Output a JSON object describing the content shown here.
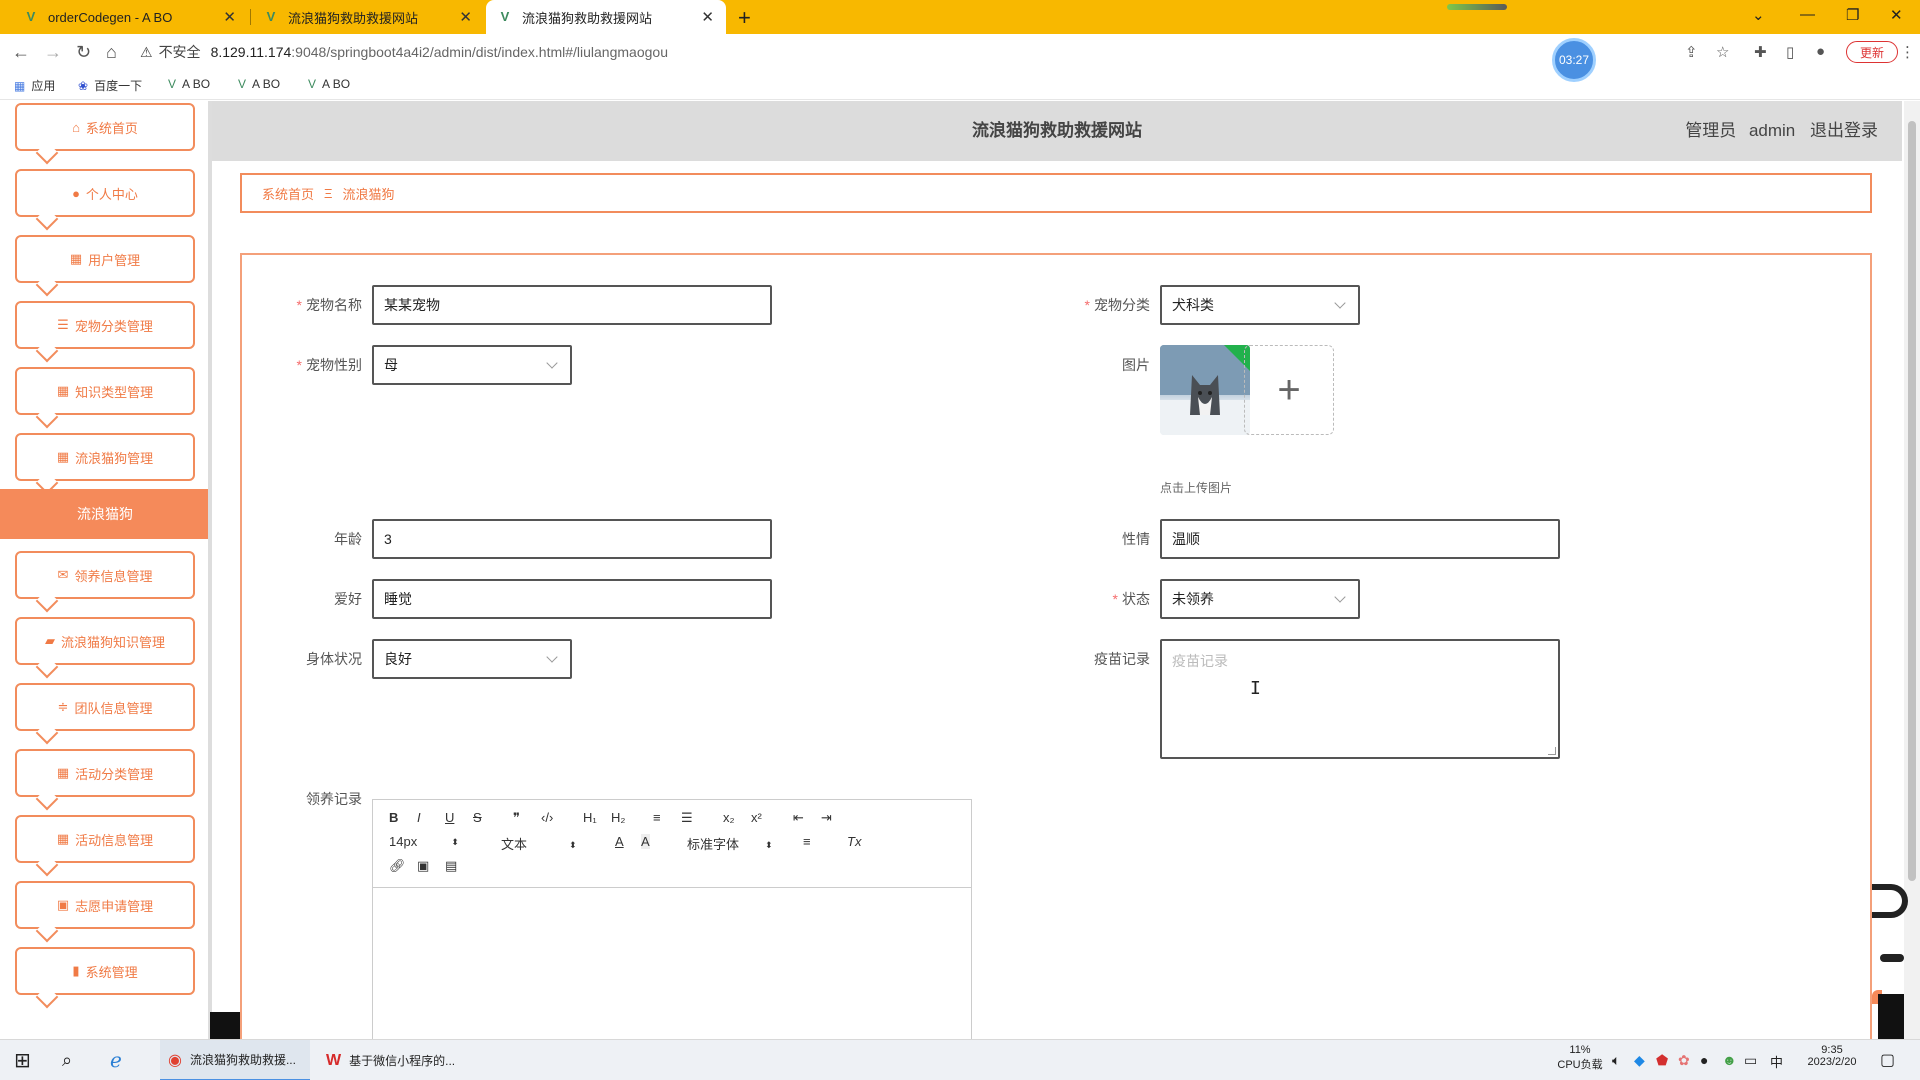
{
  "browser": {
    "tabs": [
      {
        "title": "orderCodegen - A BO",
        "icon": "vue-favicon"
      },
      {
        "title": "流浪猫狗救助救援网站",
        "icon": "vue-favicon"
      },
      {
        "title": "流浪猫狗救助救援网站",
        "icon": "vue-favicon",
        "active": true
      }
    ],
    "insecure_label": "不安全",
    "url_host": "8.129.11.174",
    "url_path": ":9048/springboot4a4i2/admin/dist/index.html#/liulangmaogou",
    "timer": "03:27",
    "update_label": "更新",
    "bookmarks": [
      {
        "label": "应用",
        "icon": "apps-grid-icon"
      },
      {
        "label": "百度一下",
        "icon": "baidu-paw-icon"
      },
      {
        "label": "A BO",
        "icon": "vue-favicon"
      },
      {
        "label": "A BO",
        "icon": "vue-favicon"
      },
      {
        "label": "A BO",
        "icon": "vue-favicon"
      }
    ]
  },
  "sidebar": {
    "items": [
      {
        "label": "系统首页",
        "icon": "home-icon"
      },
      {
        "label": "个人中心",
        "icon": "user-icon"
      },
      {
        "label": "用户管理",
        "icon": "grid-icon"
      },
      {
        "label": "宠物分类管理",
        "icon": "list-icon"
      },
      {
        "label": "知识类型管理",
        "icon": "grid-icon"
      },
      {
        "label": "流浪猫狗管理",
        "icon": "grid-icon"
      },
      {
        "label": "领养信息管理",
        "icon": "ticket-icon"
      },
      {
        "label": "流浪猫狗知识管理",
        "icon": "briefcase-icon"
      },
      {
        "label": "团队信息管理",
        "icon": "sliders-icon"
      },
      {
        "label": "活动分类管理",
        "icon": "grid-icon"
      },
      {
        "label": "活动信息管理",
        "icon": "grid-icon"
      },
      {
        "label": "志愿申请管理",
        "icon": "clipboard-icon"
      },
      {
        "label": "系统管理",
        "icon": "bar-chart-icon"
      }
    ],
    "active_sub": "流浪猫狗"
  },
  "header": {
    "title": "流浪猫狗救助救援网站",
    "role": "管理员",
    "username": "admin",
    "logout": "退出登录"
  },
  "breadcrumb": {
    "home": "系统首页",
    "separator": "Ξ",
    "current": "流浪猫狗"
  },
  "form": {
    "pet_name": {
      "label": "宠物名称",
      "value": "某某宠物",
      "required": true
    },
    "pet_category": {
      "label": "宠物分类",
      "value": "犬科类",
      "required": true
    },
    "pet_gender": {
      "label": "宠物性别",
      "value": "母",
      "required": true
    },
    "image": {
      "label": "图片",
      "hint": "点击上传图片"
    },
    "age": {
      "label": "年龄",
      "value": "3"
    },
    "temperament": {
      "label": "性情",
      "value": "温顺"
    },
    "hobby": {
      "label": "爱好",
      "value": "睡觉"
    },
    "status": {
      "label": "状态",
      "value": "未领养",
      "required": true
    },
    "health": {
      "label": "身体状况",
      "value": "良好"
    },
    "vaccine": {
      "label": "疫苗记录",
      "placeholder": "疫苗记录"
    },
    "adoption_record": {
      "label": "领养记录"
    }
  },
  "editor": {
    "font_size": "14px",
    "text_type": "文本",
    "font_family": "标准字体",
    "buttons_row1": [
      "B",
      "I",
      "U",
      "S",
      "❞",
      "‹/›",
      "H₁",
      "H₂",
      "≡",
      "☰",
      "x₂",
      "x²",
      "⇤",
      "⇥"
    ],
    "color_btn": "A",
    "bg_btn": "A",
    "align_btn": "≡",
    "clear_btn": "Tx"
  },
  "taskbar": {
    "apps": [
      {
        "label": "流浪猫狗救助救援...",
        "icon": "chrome-icon"
      },
      {
        "label": "基于微信小程序的...",
        "icon": "wps-icon"
      }
    ],
    "cpu_percent": "11%",
    "cpu_label": "CPU负载",
    "ime": "中",
    "time": "9:35",
    "date": "2023/2/20"
  }
}
